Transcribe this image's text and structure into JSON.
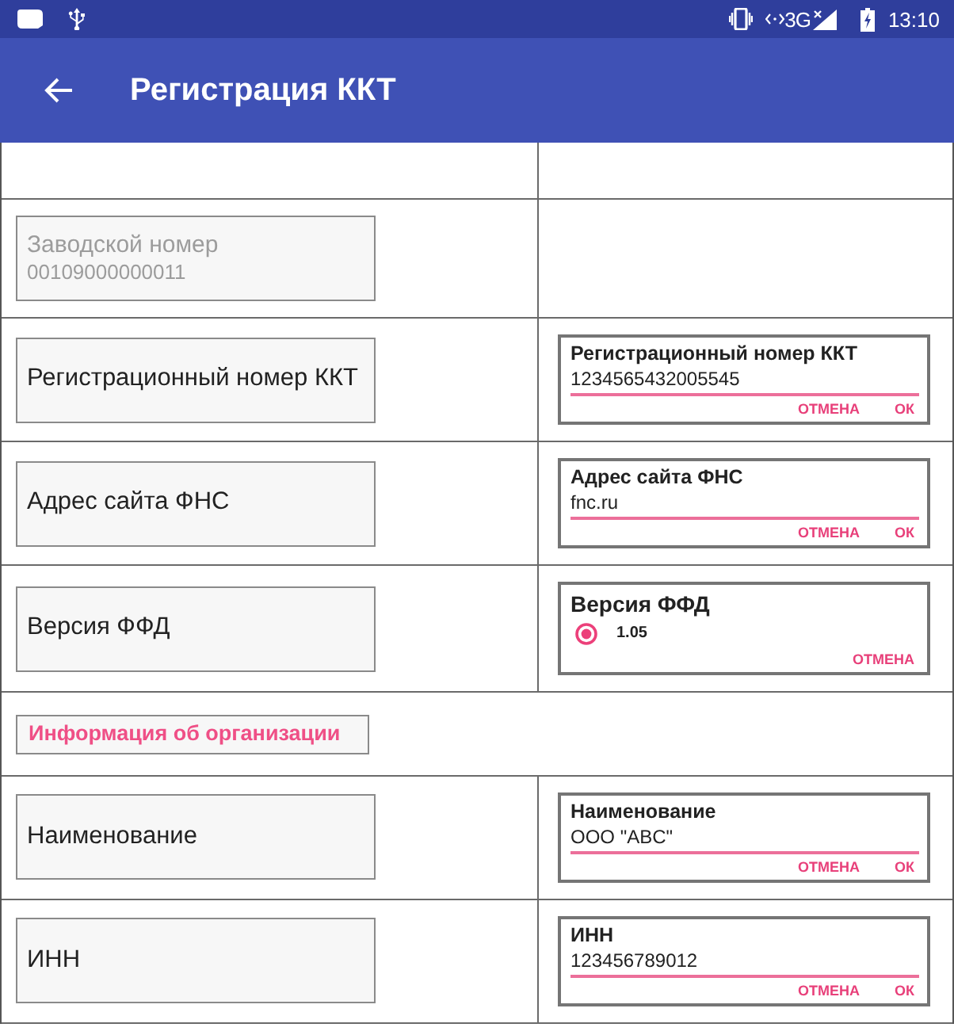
{
  "status_bar": {
    "network": "3G",
    "time": "13:10"
  },
  "app_bar": {
    "title": "Регистрация ККТ"
  },
  "rows": [
    {
      "kind": "blank"
    },
    {
      "kind": "setting",
      "title": "Заводской номер",
      "value": "00109000000011",
      "disabled": true
    },
    {
      "kind": "setting",
      "title": "Регистрационный номер ККТ",
      "disabled": false,
      "editor": {
        "kind": "text",
        "title": "Регистрационный номер ККТ",
        "value": "1234565432005545",
        "buttons": [
          "ОТМЕНА",
          "ОК"
        ]
      }
    },
    {
      "kind": "setting",
      "title": "Адрес сайта ФНС",
      "disabled": false,
      "editor": {
        "kind": "text",
        "title": "Адрес сайта ФНС",
        "value": "fnc.ru",
        "buttons": [
          "ОТМЕНА",
          "ОК"
        ]
      }
    },
    {
      "kind": "setting",
      "title": "Версия ФФД",
      "disabled": false,
      "editor": {
        "kind": "radio",
        "title": "Версия ФФД",
        "options": [
          {
            "label": "1.05",
            "selected": true
          }
        ],
        "buttons": [
          "ОТМЕНА"
        ]
      }
    },
    {
      "kind": "section",
      "title": "Информация об организации"
    },
    {
      "kind": "setting",
      "title": "Наименование",
      "disabled": false,
      "editor": {
        "kind": "text",
        "title": "Наименование",
        "value": "ООО \"ABC\"",
        "buttons": [
          "ОТМЕНА",
          "ОК"
        ]
      }
    },
    {
      "kind": "setting",
      "title": "ИНН",
      "disabled": false,
      "editor": {
        "kind": "text",
        "title": "ИНН",
        "value": "123456789012",
        "buttons": [
          "ОТМЕНА",
          "ОК"
        ]
      }
    }
  ]
}
